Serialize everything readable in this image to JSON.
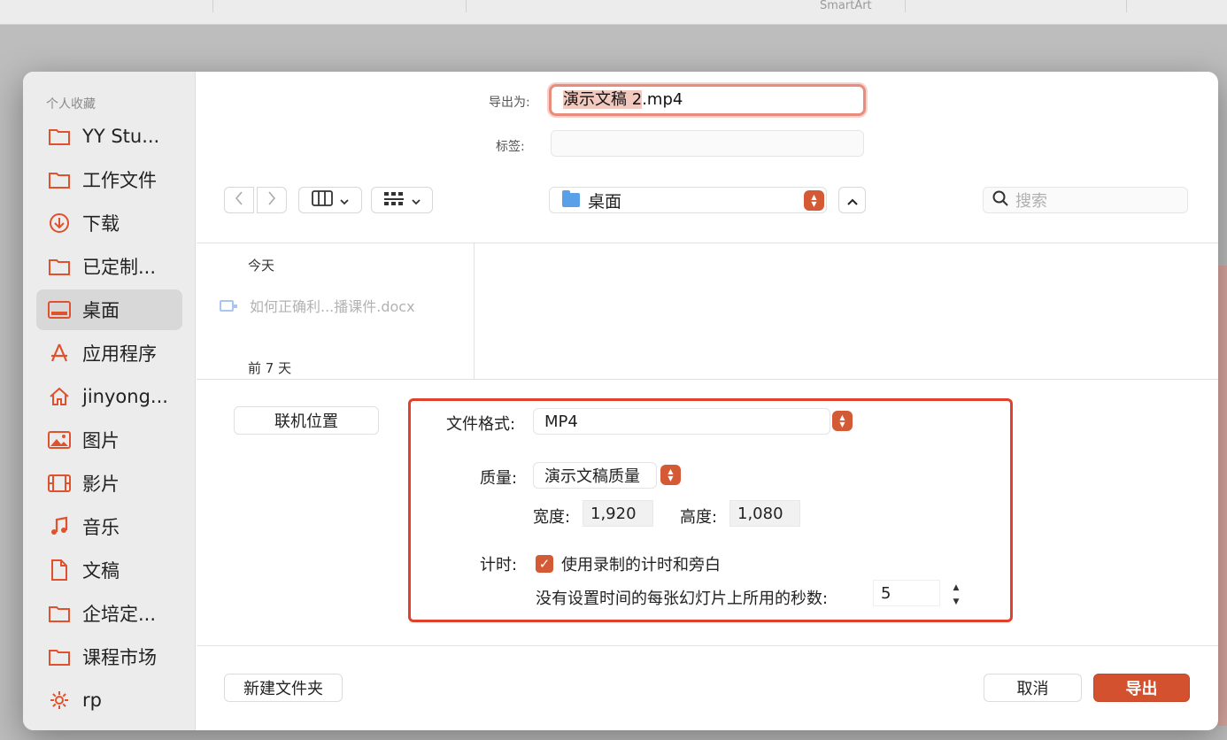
{
  "background": {
    "ribbon_label": "SmartArt"
  },
  "sidebar": {
    "section_title": "个人收藏",
    "items": [
      {
        "label": "YY Stu...",
        "icon": "folder-icon"
      },
      {
        "label": "工作文件",
        "icon": "folder-icon"
      },
      {
        "label": "下载",
        "icon": "download-icon"
      },
      {
        "label": "已定制...",
        "icon": "folder-icon"
      },
      {
        "label": "桌面",
        "icon": "desktop-icon",
        "selected": true
      },
      {
        "label": "应用程序",
        "icon": "apps-icon"
      },
      {
        "label": "jinyong...",
        "icon": "home-icon"
      },
      {
        "label": "图片",
        "icon": "photo-icon"
      },
      {
        "label": "影片",
        "icon": "film-icon"
      },
      {
        "label": "音乐",
        "icon": "music-icon"
      },
      {
        "label": "文稿",
        "icon": "document-icon"
      },
      {
        "label": "企培定...",
        "icon": "folder-icon"
      },
      {
        "label": "课程市场",
        "icon": "folder-icon"
      },
      {
        "label": "rp",
        "icon": "gear-icon"
      }
    ]
  },
  "save": {
    "export_as_label": "导出为:",
    "filename_selected": "演示文稿 2",
    "filename_ext": ".mp4",
    "tags_label": "标签:",
    "tags_value": ""
  },
  "toolbar": {
    "location": "桌面",
    "search_placeholder": "搜索"
  },
  "browser": {
    "group_today": "今天",
    "file_name": "如何正确利...播课件.docx",
    "group_week": "前 7 天"
  },
  "online_locations_label": "联机位置",
  "options": {
    "format_label": "文件格式:",
    "format_value": "MP4",
    "quality_label": "质量:",
    "quality_value": "演示文稿质量",
    "width_label": "宽度:",
    "width_value": "1,920",
    "height_label": "高度:",
    "height_value": "1,080",
    "timing_label": "计时:",
    "timing_checkbox_label": "使用录制的计时和旁白",
    "timing_checked": true,
    "seconds_label": "没有设置时间的每张幻灯片上所用的秒数:",
    "seconds_value": "5"
  },
  "footer": {
    "new_folder": "新建文件夹",
    "cancel": "取消",
    "export": "导出"
  },
  "colors": {
    "accent": "#d4512f",
    "highlight_border": "#e0412c"
  }
}
